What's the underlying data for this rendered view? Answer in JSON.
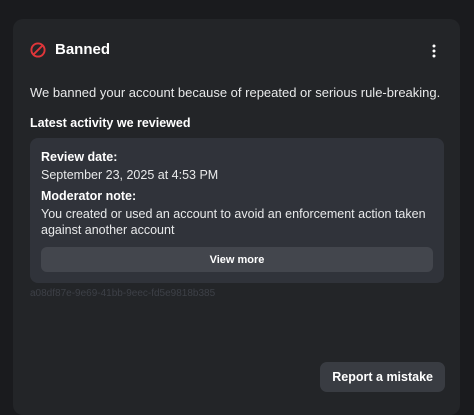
{
  "header": {
    "title": "Banned",
    "status_icon": "ban-icon",
    "status_color": "#e0363a",
    "menu_icon": "more-vertical-icon"
  },
  "message": "We banned your account because of repeated or serious rule-breaking.",
  "activity": {
    "heading": "Latest activity we reviewed",
    "review_date_label": "Review date:",
    "review_date": "September 23, 2025 at 4:53 PM",
    "note_label": "Moderator note:",
    "note": "You created or used an account to avoid an enforcement action taken against another account",
    "view_more_label": "View more"
  },
  "reference_id": "a08df87e-9e69-41bb-9eec-fd5e9818b385",
  "actions": {
    "report_label": "Report a mistake"
  },
  "colors": {
    "background": "#1a1b1e",
    "panel": "#232528",
    "card": "#30333a",
    "button": "#43464d"
  }
}
